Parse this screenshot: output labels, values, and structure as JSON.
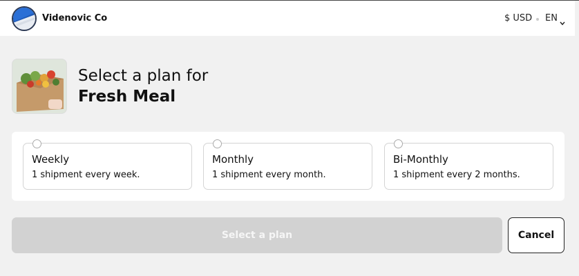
{
  "header": {
    "brand_name": "Videnovic Co",
    "currency_label": "$ USD",
    "language_label": "EN",
    "logo_icon": "globe-logo-icon",
    "language_icon": "chevron-down-icon"
  },
  "product": {
    "image_icon": "meal-box-photo",
    "title_prefix": "Select a plan for",
    "product_name": "Fresh Meal"
  },
  "plans": [
    {
      "name": "Weekly",
      "description": "1 shipment every week.",
      "selected": false
    },
    {
      "name": "Monthly",
      "description": "1 shipment every month.",
      "selected": false
    },
    {
      "name": "Bi-Monthly",
      "description": "1 shipment every 2 months.",
      "selected": false
    }
  ],
  "actions": {
    "select_plan_label": "Select a plan",
    "select_plan_enabled": false,
    "cancel_label": "Cancel"
  },
  "colors": {
    "page_background": "#f1f1f1",
    "disabled_button": "#d2d2d2",
    "logo_blue": "#1f5bb8"
  }
}
